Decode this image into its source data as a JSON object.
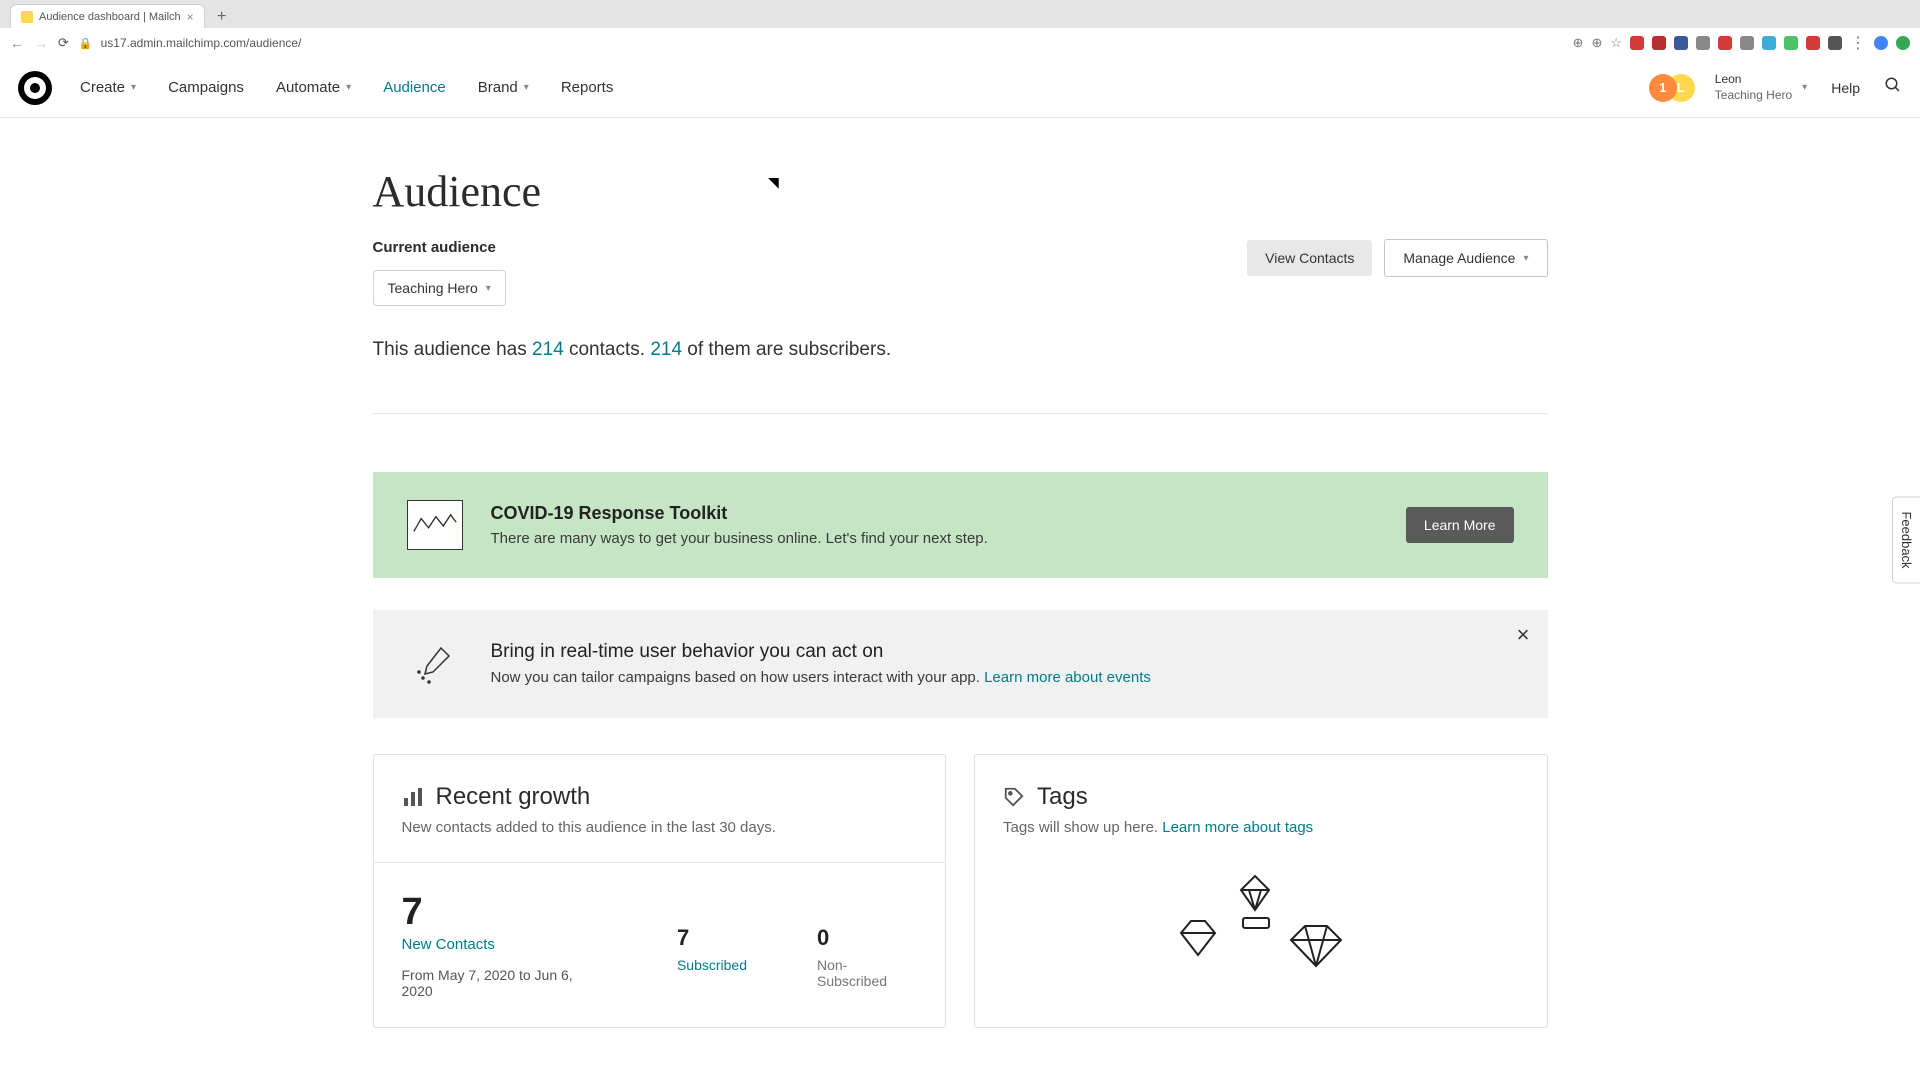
{
  "browser": {
    "tab_title": "Audience dashboard | Mailch",
    "url": "us17.admin.mailchimp.com/audience/"
  },
  "nav": {
    "create": "Create",
    "campaigns": "Campaigns",
    "automate": "Automate",
    "audience": "Audience",
    "brand": "Brand",
    "reports": "Reports"
  },
  "user": {
    "name": "Leon",
    "org": "Teaching Hero",
    "help": "Help"
  },
  "page": {
    "title": "Audience",
    "current_label": "Current audience",
    "audience_name": "Teaching Hero",
    "view_contacts": "View Contacts",
    "manage_audience": "Manage Audience",
    "summary_prefix": "This audience has ",
    "contacts_count": "214",
    "summary_mid": " contacts. ",
    "subscribers_count": "214",
    "summary_suffix": " of them are subscribers."
  },
  "banner_green": {
    "title": "COVID-19 Response Toolkit",
    "subtitle": "There are many ways to get your business online. Let's find your next step.",
    "cta": "Learn More"
  },
  "banner_grey": {
    "title": "Bring in real-time user behavior you can act on",
    "subtitle": "Now you can tailor campaigns based on how users interact with your app. ",
    "link": "Learn more about events"
  },
  "growth": {
    "title": "Recent growth",
    "subtitle": "New contacts added to this audience in the last 30 days.",
    "big_num": "7",
    "new_contacts_label": "New Contacts",
    "date_range": "From May 7, 2020 to Jun 6, 2020",
    "subscribed_num": "7",
    "subscribed_label": "Subscribed",
    "nonsub_num": "0",
    "nonsub_label": "Non-Subscribed"
  },
  "tags": {
    "title": "Tags",
    "subtitle": "Tags will show up here. ",
    "link": "Learn more about tags"
  },
  "feedback": "Feedback"
}
